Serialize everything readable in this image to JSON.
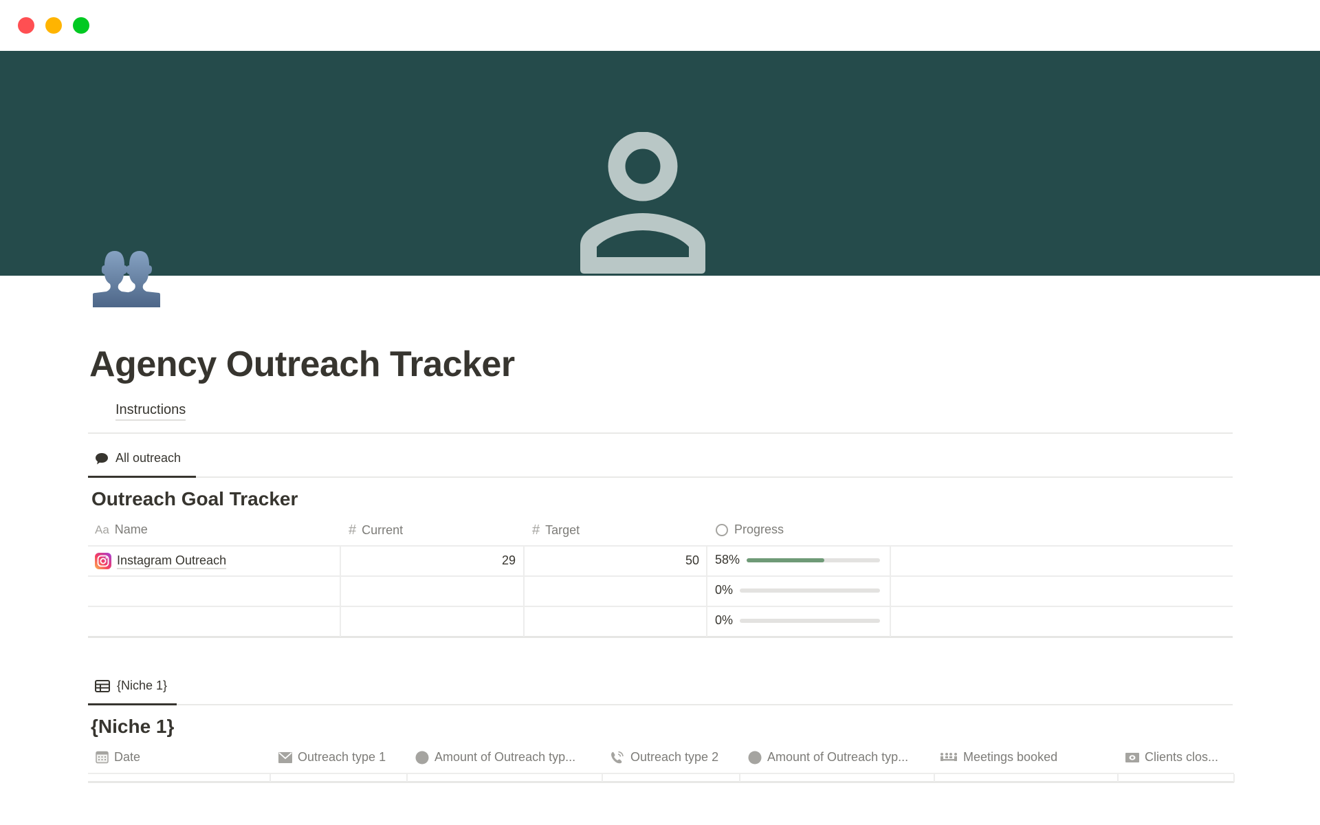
{
  "window": {
    "controls": [
      "close",
      "minimize",
      "maximize"
    ]
  },
  "colors": {
    "banner": "#254b4b",
    "banner_icon": "#b9c7c6",
    "progress_fill": "#6f9a77",
    "progress_track": "#e3e2e0",
    "text": "#37352f",
    "muted": "#7d7c78"
  },
  "page": {
    "cover_icon": "person-outline-icon",
    "emoji_icon": "busts-in-silhouette-icon",
    "title": "Agency Outreach Tracker",
    "instructions_link": "Instructions"
  },
  "goal_view": {
    "tab": {
      "icon": "speech-bubble-icon",
      "label": "All outreach"
    },
    "title": "Outreach Goal Tracker",
    "columns": [
      {
        "icon": "Aa",
        "label": "Name"
      },
      {
        "icon": "#",
        "label": "Current"
      },
      {
        "icon": "#",
        "label": "Target"
      },
      {
        "icon": "circle-progress-icon",
        "label": "Progress"
      }
    ],
    "rows": [
      {
        "icon": "instagram-icon",
        "name": "Instagram Outreach",
        "current": "29",
        "target": "50",
        "progress_label": "58%",
        "progress": 0.58
      },
      {
        "icon": "",
        "name": "",
        "current": "",
        "target": "",
        "progress_label": "0%",
        "progress": 0
      },
      {
        "icon": "",
        "name": "",
        "current": "",
        "target": "",
        "progress_label": "0%",
        "progress": 0
      }
    ]
  },
  "niche_view": {
    "tab": {
      "icon": "table-icon",
      "label": "{Niche 1}"
    },
    "title": "{Niche 1}",
    "columns": [
      {
        "icon": "calendar-icon",
        "label": "Date"
      },
      {
        "icon": "envelope-icon",
        "label": "Outreach type 1"
      },
      {
        "icon": "circle-icon",
        "label": "Amount of Outreach typ..."
      },
      {
        "icon": "phone-icon",
        "label": "Outreach type 2"
      },
      {
        "icon": "circle-icon",
        "label": "Amount of Outreach typ..."
      },
      {
        "icon": "meeting-icon",
        "label": "Meetings booked"
      },
      {
        "icon": "money-icon",
        "label": "Clients clos..."
      }
    ]
  }
}
